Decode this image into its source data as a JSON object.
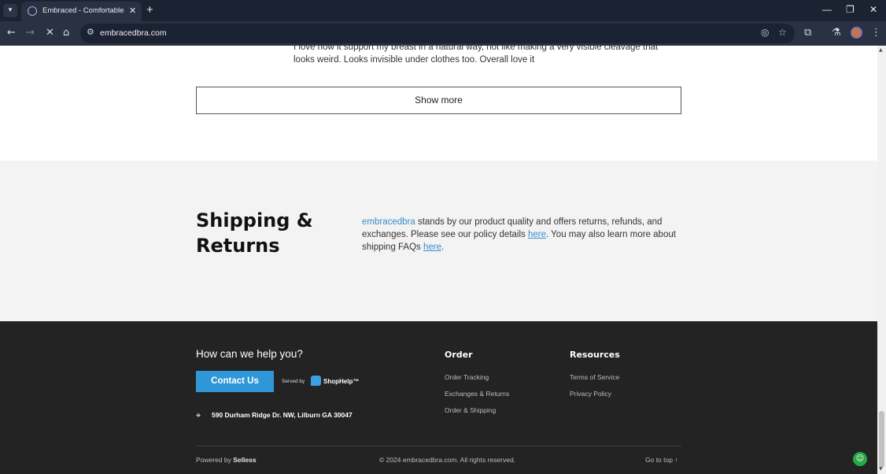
{
  "browser": {
    "tab_dropdown_icon": "chevron-down-icon",
    "tab_title": "Embraced - Comfortable & Sup",
    "tab_close": "✕",
    "new_tab": "+",
    "minimize": "—",
    "restore": "❐",
    "close": "✕",
    "back": "←",
    "forward": "→",
    "stop": "✕",
    "home": "⌂",
    "site_info": "⚙",
    "url": "embracedbra.com",
    "eye_off": "◎",
    "star": "☆",
    "extensions": "⧉",
    "labs": "⚗",
    "menu": "⋮"
  },
  "review": {
    "text": "I love how it support my breast in a natural way, not like making a very visible cleavage that looks weird. Looks invisible under clothes too. Overall love it"
  },
  "show_more_label": "Show more",
  "shipping": {
    "title": "Shipping & Returns",
    "brand": "embracedbra",
    "text_1": " stands by our product quality and offers returns, refunds, and exchanges. Please see our policy details ",
    "link_1": "here",
    "text_2": ". You may also learn more about shipping FAQs ",
    "link_2": "here",
    "text_3": "."
  },
  "footer": {
    "help_title": "How can we help you?",
    "contact_label": "Contact Us",
    "served_by": "Served by",
    "shophelp": "ShopHelp™",
    "address": "590 Durham Ridge Dr. NW, Lilburn GA 30047",
    "order_title": "Order",
    "order_links": [
      "Order Tracking",
      "Exchanges & Returns",
      "Order & Shipping"
    ],
    "resources_title": "Resources",
    "resources_links": [
      "Terms of Service",
      "Privacy Policy"
    ],
    "powered_prefix": "Powered by ",
    "powered_brand": "Selless",
    "copyright": "© 2024 embracedbra.com. All rights reserved.",
    "goto_top": "Go to top ↑"
  },
  "colors": {
    "accent": "#2f97d8",
    "footer_bg": "#232323",
    "shipping_bg": "#f3f3f3"
  }
}
